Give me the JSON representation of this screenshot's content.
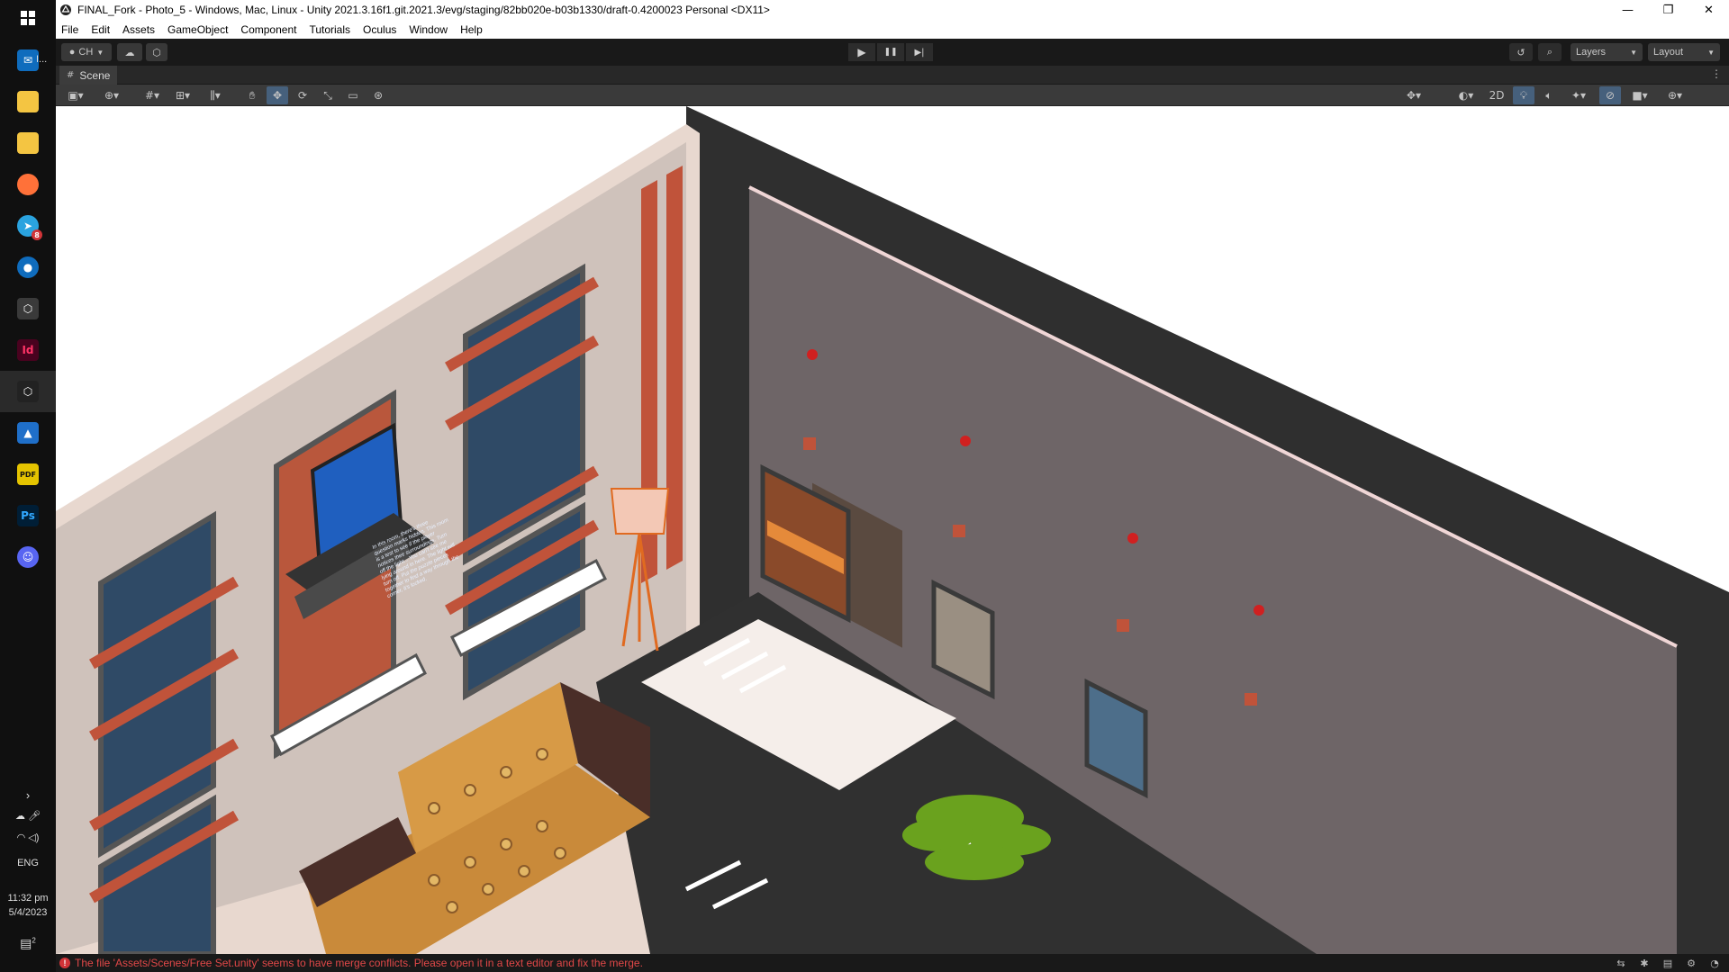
{
  "window": {
    "title": "FINAL_Fork - Photo_5 - Windows, Mac, Linux - Unity 2021.3.16f1.git.2021.3/evg/staging/82bb020e-b03b1330/draft-0.4200023 Personal <DX11>",
    "minimize": "—",
    "restore": "❐",
    "close": "✕"
  },
  "menu": [
    "File",
    "Edit",
    "Assets",
    "GameObject",
    "Component",
    "Tutorials",
    "Oculus",
    "Window",
    "Help"
  ],
  "toolbar": {
    "account_label": "CH",
    "layers_label": "Layers",
    "layout_label": "Layout",
    "play": "▶",
    "pause": "❚❚",
    "step": "▶|"
  },
  "scene_tab": {
    "label": "Scene",
    "more": "⋮"
  },
  "scene_tools": {
    "mode_2d": "2D"
  },
  "scene": {
    "monitor_text": "In this room, there's three question marks hidden. This room is a test to see if the player notices their surroundings. Turn off the light... You can't see me lying around in here. The light will turn off. Put the puzzle pieces together to find a way through the corner, it's locked."
  },
  "taskbar": {
    "start_icon": "windows-logo",
    "mail_label": "I...",
    "apps": [
      "mail",
      "file-explorer",
      "files",
      "firefox",
      "telegram",
      "maps",
      "unity-hub",
      "indesign",
      "unity",
      "photos",
      "pdf-reader",
      "photoshop",
      "discord"
    ],
    "telegram_badge": "8",
    "indesign_label": "Id",
    "photoshop_label": "Ps",
    "language": "ENG",
    "time": "11:32 pm",
    "date": "5/4/2023",
    "notification_count": "2"
  },
  "status": {
    "message": "The file 'Assets/Scenes/Free Set.unity' seems to have merge conflicts. Please open it in a text editor and fix the merge."
  },
  "colors": {
    "wall_dark": "#6e6567",
    "wall_frame": "#2f2f2f",
    "window_blue": "#2f4a66",
    "accent_orange": "#c0533a",
    "error_red": "#e14848"
  }
}
